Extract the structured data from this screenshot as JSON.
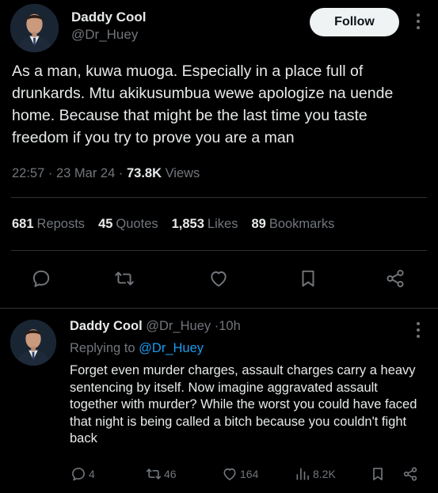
{
  "main_tweet": {
    "author_name": "Daddy Cool",
    "author_handle": "@Dr_Huey",
    "follow_label": "Follow",
    "text": "As a man, kuwa muoga. Especially in a place full of drunkards. Mtu akikusumbua wewe apologize na uende home. Because that might be the last time you taste freedom if you try to prove you are a man",
    "time": "22:57",
    "date": "23 Mar 24",
    "views_count": "73.8K",
    "views_label": "Views",
    "separator": "·",
    "stats": [
      {
        "count": "681",
        "label": "Reposts"
      },
      {
        "count": "45",
        "label": "Quotes"
      },
      {
        "count": "1,853",
        "label": "Likes"
      },
      {
        "count": "89",
        "label": "Bookmarks"
      }
    ],
    "actions": [
      "reply-icon",
      "repost-icon",
      "like-icon",
      "bookmark-icon",
      "share-icon"
    ]
  },
  "reply_tweet": {
    "author_name": "Daddy Cool",
    "author_handle": "@Dr_Huey",
    "separator": "·",
    "time_ago": "10h",
    "replying_prefix": "Replying to",
    "replying_to": "@Dr_Huey",
    "text": "Forget even murder charges, assault charges carry a heavy sentencing by itself. Now imagine aggravated assault together with murder? While the worst you could have faced that night is being called a bitch because you couldn't fight back",
    "counts": {
      "replies": "4",
      "reposts": "46",
      "likes": "164",
      "views": "8.2K"
    }
  },
  "colors": {
    "background": "#000000",
    "text": "#e7e9ea",
    "muted": "#71767b",
    "link": "#1d9bf0",
    "divider": "#2f3336",
    "follow_bg": "#eff3f4"
  }
}
